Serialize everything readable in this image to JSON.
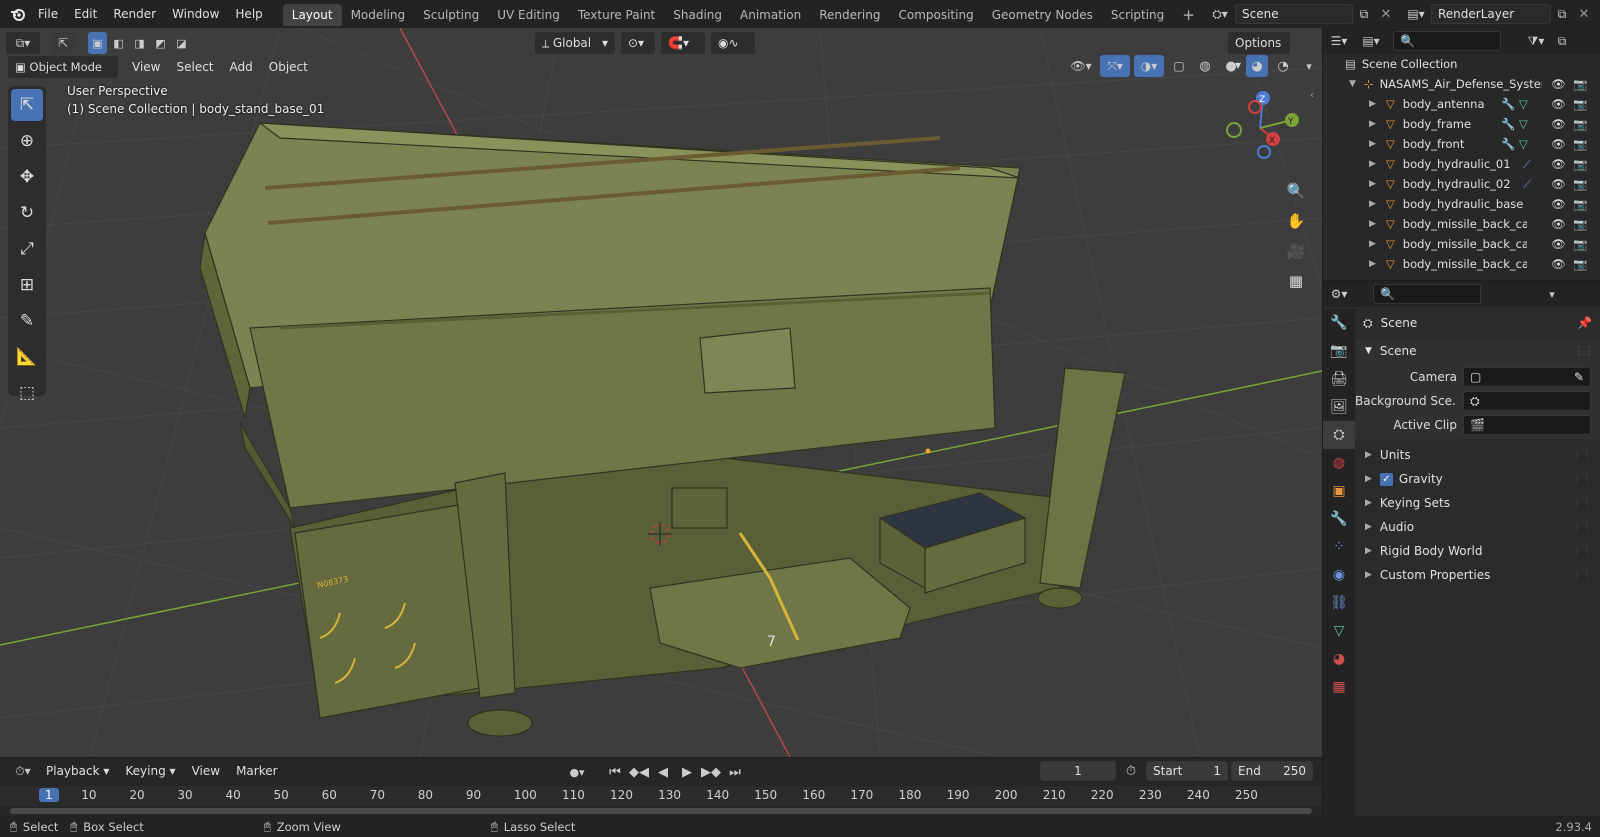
{
  "topbar": {
    "menus": [
      "File",
      "Edit",
      "Render",
      "Window",
      "Help"
    ],
    "workspaces": [
      "Layout",
      "Modeling",
      "Sculpting",
      "UV Editing",
      "Texture Paint",
      "Shading",
      "Animation",
      "Rendering",
      "Compositing",
      "Geometry Nodes",
      "Scripting"
    ],
    "active_workspace": "Layout",
    "add_tab": "+",
    "scene_name": "Scene",
    "view_layer": "RenderLayer"
  },
  "viewport": {
    "mode": "Object Mode",
    "menus": [
      "View",
      "Select",
      "Add",
      "Object"
    ],
    "transform_orientation": "Global",
    "options_label": "Options",
    "overlay_line1": "User Perspective",
    "overlay_line2": "(1) Scene Collection | body_stand_base_01",
    "gizmo_axes": {
      "x": "X",
      "y": "Y",
      "z": "Z"
    },
    "model_marking": "N08373",
    "model_number": "7"
  },
  "timeline": {
    "menus": [
      "Playback",
      "Keying",
      "View",
      "Marker"
    ],
    "current_frame": "1",
    "start_label": "Start",
    "start_value": "1",
    "end_label": "End",
    "end_value": "250",
    "ruler": [
      "1",
      "10",
      "20",
      "30",
      "40",
      "50",
      "60",
      "70",
      "80",
      "90",
      "100",
      "110",
      "120",
      "130",
      "140",
      "150",
      "160",
      "170",
      "180",
      "190",
      "200",
      "210",
      "220",
      "230",
      "240",
      "250"
    ]
  },
  "outliner": {
    "root": "Scene Collection",
    "collection": "NASAMS_Air_Defense_Syster",
    "items": [
      {
        "name": "body_antenna",
        "mods": "wrench+mesh"
      },
      {
        "name": "body_frame",
        "mods": "wrench+mesh"
      },
      {
        "name": "body_front",
        "mods": "wrench+mesh"
      },
      {
        "name": "body_hydraulic_01",
        "mods": "constraint"
      },
      {
        "name": "body_hydraulic_02",
        "mods": "constraint"
      },
      {
        "name": "body_hydraulic_base",
        "mods": ""
      },
      {
        "name": "body_missile_back_cap_(",
        "mods": ""
      },
      {
        "name": "body_missile_back_cap_(",
        "mods": ""
      },
      {
        "name": "body_missile_back_cap_(",
        "mods": ""
      }
    ]
  },
  "properties": {
    "header": "Scene",
    "panel_title": "Scene",
    "fields": [
      {
        "label": "Camera",
        "value": ""
      },
      {
        "label": "Background Sce...",
        "value": ""
      },
      {
        "label": "Active Clip",
        "value": ""
      }
    ],
    "sections": [
      "Units",
      "Gravity",
      "Keying Sets",
      "Audio",
      "Rigid Body World",
      "Custom Properties"
    ],
    "gravity_checked": true
  },
  "statusbar": {
    "items": [
      "Select",
      "Box Select",
      "Zoom View",
      "Lasso Select"
    ],
    "version": "2.93.4"
  },
  "colors": {
    "accent": "#4772b3",
    "model_green": "#6b7244",
    "frame_marker": "#4772b3",
    "axis_red": "#c0392b",
    "axis_green": "#6a9c2a"
  }
}
